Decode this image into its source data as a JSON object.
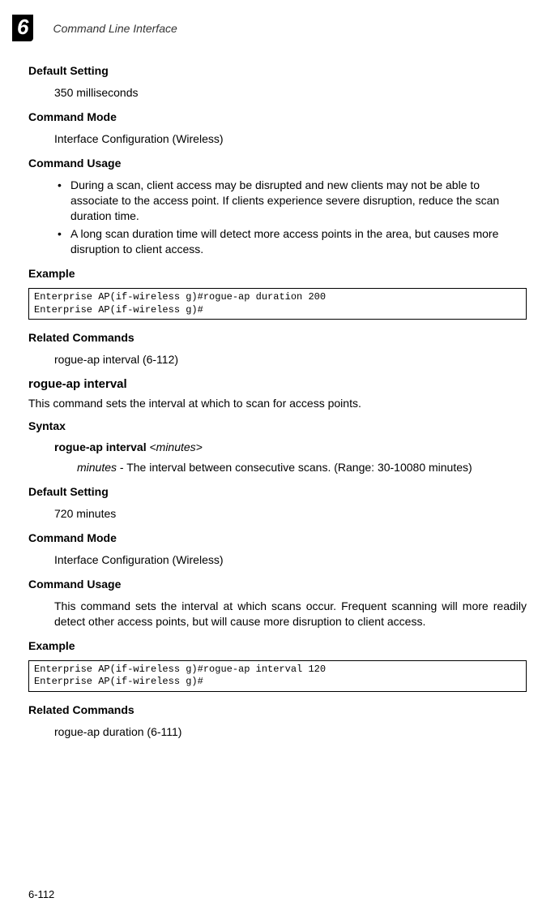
{
  "header": {
    "chapter_num": "6",
    "title": "Command Line Interface"
  },
  "s1": {
    "default_setting_h": "Default Setting",
    "default_setting_v": "350 milliseconds",
    "command_mode_h": "Command Mode",
    "command_mode_v": "Interface Configuration (Wireless)",
    "command_usage_h": "Command Usage",
    "usage_b1": "During a scan, client access may be disrupted and new clients may not be able to associate to the access point. If clients experience severe disruption, reduce the scan duration time.",
    "usage_b2": "A long scan duration time will detect more access points in the area, but causes more disruption to client access.",
    "example_h": "Example",
    "example_code": "Enterprise AP(if-wireless g)#rogue-ap duration 200\nEnterprise AP(if-wireless g)#",
    "related_h": "Related Commands",
    "related_v": "rogue-ap interval (6-112)"
  },
  "s2": {
    "title": "rogue-ap interval",
    "intro": "This command sets the interval at which to scan for access points.",
    "syntax_h": "Syntax",
    "syntax_cmd": "rogue-ap interval",
    "syntax_param": "<minutes>",
    "syntax_desc_param": "minutes",
    "syntax_desc_rest": " - The interval between consecutive scans. (Range: 30-10080 minutes)",
    "default_setting_h": "Default Setting",
    "default_setting_v": "720 minutes",
    "command_mode_h": "Command Mode",
    "command_mode_v": "Interface Configuration (Wireless)",
    "command_usage_h": "Command Usage",
    "usage_p": "This command sets the interval at which scans occur. Frequent scanning will more readily detect other access points, but will cause more disruption to client access.",
    "example_h": "Example",
    "example_code": "Enterprise AP(if-wireless g)#rogue-ap interval 120\nEnterprise AP(if-wireless g)#",
    "related_h": "Related Commands",
    "related_v": "rogue-ap duration (6-111)"
  },
  "footer": {
    "page": "6-112"
  }
}
